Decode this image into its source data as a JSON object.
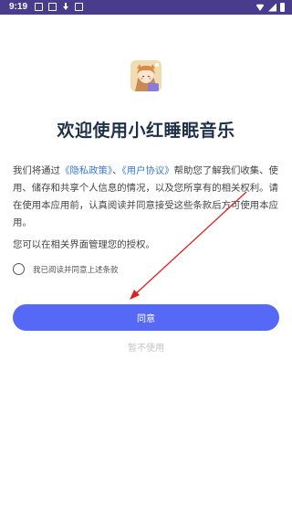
{
  "status_bar": {
    "time": "9:19",
    "left_icons": [
      "settings-icon",
      "image-icon",
      "download-icon",
      "font-icon"
    ],
    "right_icons": [
      "wifi-icon",
      "signal-icon",
      "battery-icon"
    ],
    "background": "#4a3c8c"
  },
  "dialog": {
    "title": "欢迎使用小红睡眠音乐",
    "agreement": {
      "part1": "我们将通过",
      "privacy_link": "《隐私政策》",
      "separator": "、",
      "terms_link": "《用户协议》",
      "part2": "帮助您了解我们收集、使用、储存和共享个人信息的情况，以及您所享有的相关权利。请在使用本应用前，认真阅读并同意接受这些条款后方可使用本应用。"
    },
    "manage_text": "您可以在相关界面管理您的授权。",
    "consent_label": "我已阅读并同意上述条款",
    "consent_checked": false,
    "agree_button": "同意",
    "decline_button": "暂不使用"
  },
  "colors": {
    "accent": "#5669f6",
    "link": "#3a78d6",
    "title": "#1e3148",
    "annotation_arrow": "#e02020"
  }
}
